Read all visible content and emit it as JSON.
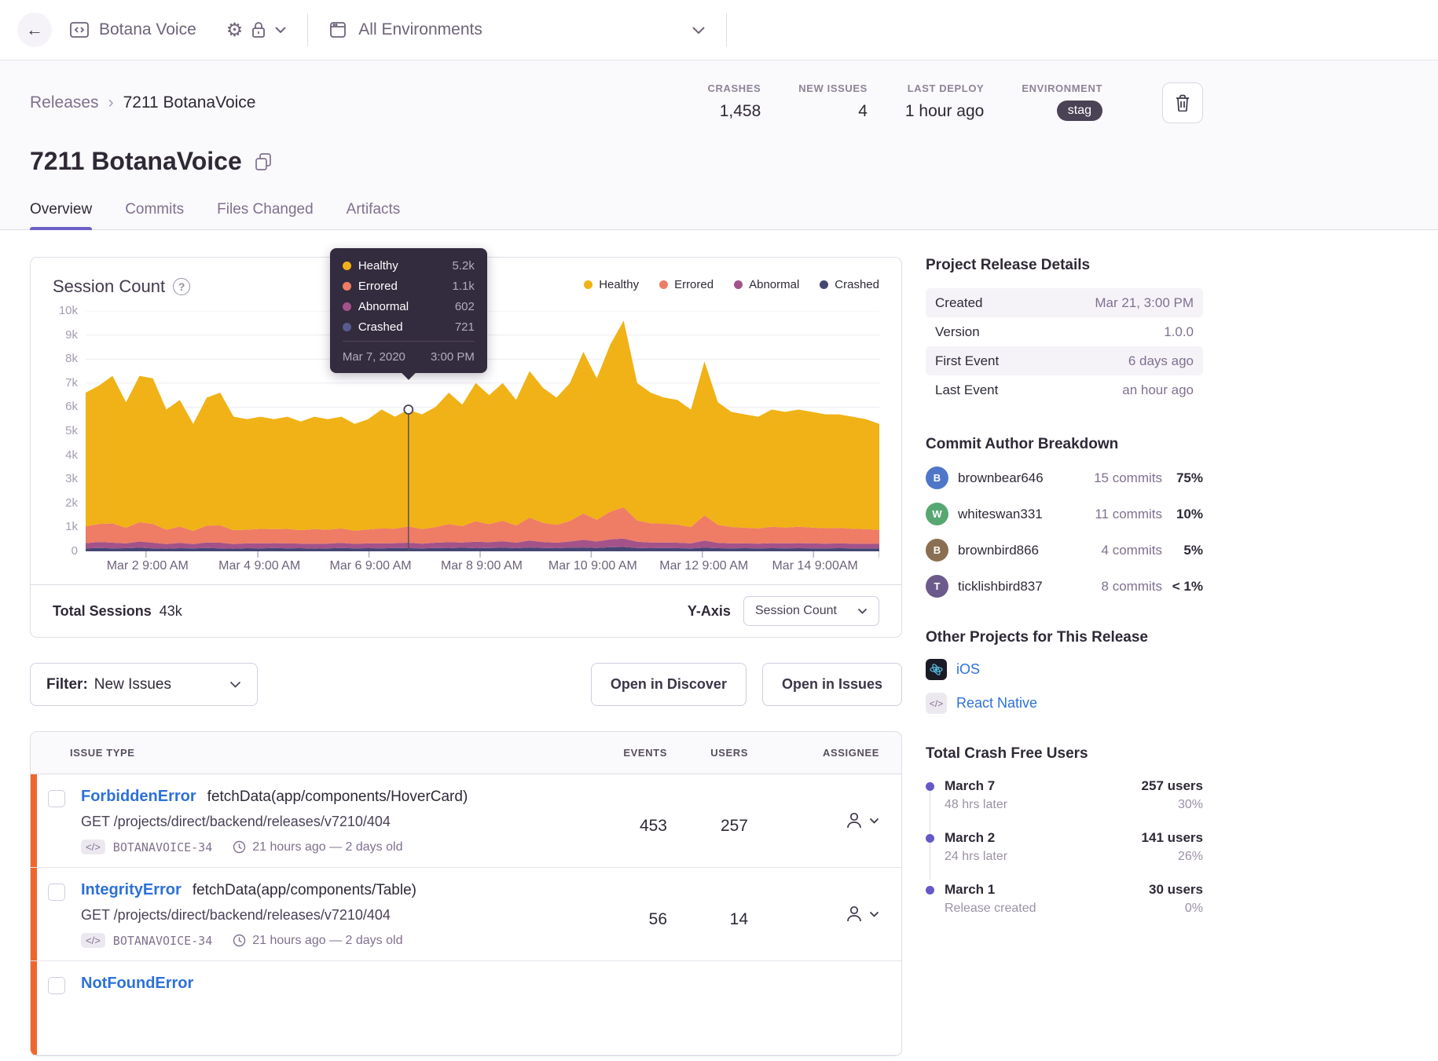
{
  "nav": {
    "project_name": "Botana Voice",
    "environment_label": "All Environments"
  },
  "header": {
    "breadcrumb": {
      "parent": "Releases",
      "current": "7211 BotanaVoice"
    },
    "title": "7211 BotanaVoice",
    "stats": [
      {
        "label": "CRASHES",
        "value": "1,458"
      },
      {
        "label": "NEW ISSUES",
        "value": "4"
      },
      {
        "label": "LAST DEPLOY",
        "value": "1 hour ago"
      },
      {
        "label": "ENVIRONMENT",
        "value": "stag"
      }
    ],
    "tabs": [
      {
        "label": "Overview"
      },
      {
        "label": "Commits"
      },
      {
        "label": "Files Changed"
      },
      {
        "label": "Artifacts"
      }
    ]
  },
  "chart_card": {
    "title": "Session Count",
    "legend": [
      {
        "label": "Healthy",
        "color": "#f0b216"
      },
      {
        "label": "Errored",
        "color": "#ef7c65"
      },
      {
        "label": "Abnormal",
        "color": "#a3538a"
      },
      {
        "label": "Crashed",
        "color": "#444674"
      }
    ],
    "tooltip": {
      "rows": [
        {
          "label": "Healthy",
          "value": "5.2k",
          "color": "#f0b216"
        },
        {
          "label": "Errored",
          "value": "1.1k",
          "color": "#ef7c65"
        },
        {
          "label": "Abnormal",
          "value": "602",
          "color": "#a3538a"
        },
        {
          "label": "Crashed",
          "value": "721",
          "color": "#575b8f"
        }
      ],
      "date": "Mar 7, 2020",
      "time": "3:00 PM"
    },
    "footer": {
      "total_label": "Total Sessions",
      "total_value": "43k",
      "yaxis_label": "Y-Axis",
      "yaxis_value": "Session Count"
    }
  },
  "chart_data": {
    "type": "area",
    "stacked": true,
    "title": "Session Count",
    "ylim": [
      0,
      10000
    ],
    "grid": true,
    "legend_position": "top-right",
    "yticks": [
      {
        "label": "0",
        "v": 0
      },
      {
        "label": "1k",
        "v": 1
      },
      {
        "label": "2k",
        "v": 2
      },
      {
        "label": "3k",
        "v": 3
      },
      {
        "label": "4k",
        "v": 4
      },
      {
        "label": "5k",
        "v": 5
      },
      {
        "label": "6k",
        "v": 6
      },
      {
        "label": "7k",
        "v": 7
      },
      {
        "label": "8k",
        "v": 8
      },
      {
        "label": "9k",
        "v": 9
      },
      {
        "label": "10k",
        "v": 10
      }
    ],
    "xticks": [
      {
        "label": "Mar 2 9:00 AM",
        "f": 0.076
      },
      {
        "label": "Mar 4 9:00 AM",
        "f": 0.217
      },
      {
        "label": "Mar 6 9:00 AM",
        "f": 0.357
      },
      {
        "label": "Mar 8 9:00 AM",
        "f": 0.497
      },
      {
        "label": "Mar 10 9:00 AM",
        "f": 0.637
      },
      {
        "label": "Mar 12 9:00 AM",
        "f": 0.777
      },
      {
        "label": "Mar 14 9:00AM",
        "f": 0.917
      }
    ],
    "edge_tick": 1.0,
    "hover": {
      "index": 24,
      "date": "Mar 7, 2020",
      "time": "3:00 PM"
    },
    "series": [
      {
        "name": "Crashed",
        "color": "#444674",
        "values": [
          0.12,
          0.14,
          0.12,
          0.13,
          0.15,
          0.12,
          0.11,
          0.13,
          0.12,
          0.14,
          0.12,
          0.11,
          0.13,
          0.12,
          0.14,
          0.12,
          0.13,
          0.11,
          0.12,
          0.14,
          0.12,
          0.13,
          0.12,
          0.14,
          0.13,
          0.12,
          0.14,
          0.13,
          0.15,
          0.13,
          0.14,
          0.15,
          0.13,
          0.16,
          0.14,
          0.13,
          0.15,
          0.16,
          0.14,
          0.17,
          0.18,
          0.14,
          0.13,
          0.14,
          0.13,
          0.12,
          0.15,
          0.13,
          0.12,
          0.13,
          0.12,
          0.13,
          0.12,
          0.13,
          0.12,
          0.12,
          0.13,
          0.12,
          0.12,
          0.12
        ]
      },
      {
        "name": "Abnormal",
        "color": "#a3538a",
        "values": [
          0.22,
          0.25,
          0.24,
          0.2,
          0.26,
          0.24,
          0.19,
          0.22,
          0.18,
          0.23,
          0.24,
          0.19,
          0.2,
          0.21,
          0.2,
          0.21,
          0.19,
          0.21,
          0.2,
          0.21,
          0.19,
          0.2,
          0.21,
          0.2,
          0.23,
          0.2,
          0.22,
          0.25,
          0.22,
          0.27,
          0.24,
          0.27,
          0.23,
          0.29,
          0.25,
          0.23,
          0.26,
          0.32,
          0.27,
          0.33,
          0.35,
          0.26,
          0.24,
          0.23,
          0.23,
          0.21,
          0.3,
          0.22,
          0.21,
          0.2,
          0.2,
          0.21,
          0.21,
          0.21,
          0.21,
          0.2,
          0.2,
          0.2,
          0.2,
          0.19
        ]
      },
      {
        "name": "Errored",
        "color": "#ef7c65",
        "values": [
          0.7,
          0.75,
          0.8,
          0.65,
          0.8,
          0.78,
          0.6,
          0.68,
          0.55,
          0.7,
          0.72,
          0.58,
          0.57,
          0.6,
          0.58,
          0.6,
          0.56,
          0.6,
          0.58,
          0.6,
          0.55,
          0.58,
          0.62,
          0.6,
          0.68,
          0.6,
          0.65,
          0.75,
          0.68,
          0.85,
          0.75,
          0.85,
          0.72,
          0.95,
          0.8,
          0.74,
          0.85,
          1.1,
          0.9,
          1.15,
          1.3,
          0.88,
          0.8,
          0.78,
          0.75,
          0.68,
          1.05,
          0.75,
          0.68,
          0.65,
          0.63,
          0.68,
          0.66,
          0.68,
          0.66,
          0.64,
          0.64,
          0.62,
          0.6,
          0.58
        ]
      },
      {
        "name": "Healthy",
        "color": "#f0b216",
        "values": [
          5.56,
          5.76,
          6.14,
          5.22,
          6.09,
          6.06,
          5.0,
          5.27,
          4.45,
          5.33,
          5.52,
          4.72,
          4.6,
          4.67,
          4.58,
          4.67,
          4.52,
          4.68,
          4.6,
          4.65,
          4.44,
          4.59,
          4.95,
          4.66,
          4.86,
          4.78,
          4.99,
          5.47,
          5.05,
          5.75,
          5.37,
          5.73,
          5.22,
          6.1,
          5.61,
          5.3,
          5.74,
          6.72,
          5.89,
          6.95,
          7.77,
          5.72,
          5.43,
          5.25,
          5.19,
          4.89,
          6.4,
          5.1,
          4.79,
          4.72,
          4.65,
          4.88,
          4.81,
          4.88,
          4.81,
          4.74,
          4.73,
          4.66,
          4.58,
          4.41
        ]
      }
    ]
  },
  "filter_bar": {
    "filter_label": "Filter:",
    "filter_value": "New Issues",
    "discover_button": "Open in Discover",
    "issues_button": "Open in Issues"
  },
  "issues_table": {
    "columns": {
      "issue": "ISSUE TYPE",
      "events": "EVENTS",
      "users": "USERS",
      "assignee": "ASSIGNEE"
    },
    "rows": [
      {
        "error": "ForbiddenError",
        "culprit": "fetchData(app/components/HoverCard)",
        "path": "GET /projects/direct/backend/releases/v7210/404",
        "short_id": "BOTANAVOICE-34",
        "age": "21 hours ago — 2 days old",
        "events": "453",
        "users": "257"
      },
      {
        "error": "IntegrityError",
        "culprit": "fetchData(app/components/Table)",
        "path": "GET /projects/direct/backend/releases/v7210/404",
        "short_id": "BOTANAVOICE-34",
        "age": "21 hours ago — 2 days old",
        "events": "56",
        "users": "14"
      },
      {
        "error": "NotFoundError"
      }
    ]
  },
  "sidebar": {
    "release_details": {
      "title": "Project Release Details",
      "rows": [
        {
          "label": "Created",
          "value": "Mar 21, 3:00 PM"
        },
        {
          "label": "Version",
          "value": "1.0.0"
        },
        {
          "label": "First Event",
          "value": "6 days ago"
        },
        {
          "label": "Last Event",
          "value": "an hour ago"
        }
      ]
    },
    "commit_authors": {
      "title": "Commit Author Breakdown",
      "rows": [
        {
          "name": "brownbear646",
          "commits": "15 commits",
          "pct": "75%",
          "initial": "B",
          "color": "#4f77c9"
        },
        {
          "name": "whiteswan331",
          "commits": "11 commits",
          "pct": "10%",
          "initial": "W",
          "color": "#57a773"
        },
        {
          "name": "brownbird866",
          "commits": "4 commits",
          "pct": "5%",
          "initial": "B",
          "color": "#8a6f52"
        },
        {
          "name": "ticklishbird837",
          "commits": "8 commits",
          "pct": "< 1%",
          "initial": "T",
          "color": "#6d5a8c"
        }
      ]
    },
    "other_projects": {
      "title": "Other Projects for This Release",
      "items": [
        {
          "name": "iOS"
        },
        {
          "name": "React Native"
        }
      ]
    },
    "crash_free": {
      "title": "Total Crash Free Users",
      "entries": [
        {
          "date": "March 7",
          "sub": "48 hrs later",
          "users": "257 users",
          "pct": "30%"
        },
        {
          "date": "March 2",
          "sub": "24 hrs later",
          "users": "141 users",
          "pct": "26%"
        },
        {
          "date": "March 1",
          "sub": "Release created",
          "users": "30 users",
          "pct": "0%"
        }
      ]
    }
  }
}
